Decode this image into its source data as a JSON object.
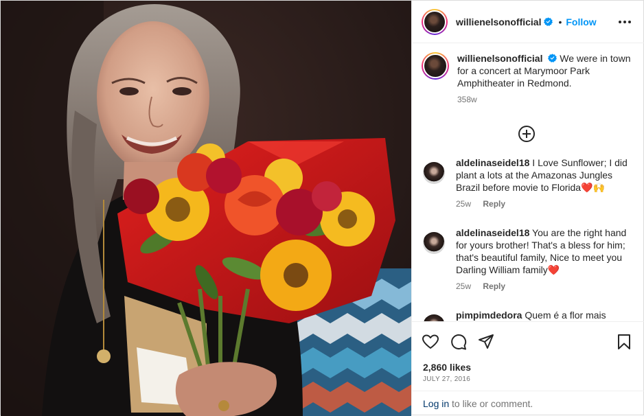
{
  "post": {
    "username": "willienelsonofficial",
    "follow_label": "Follow",
    "separator": "•",
    "verified": true,
    "caption": "We were in town for a concert at Marymoor Park Amphitheater in Redmond.",
    "caption_age": "358w",
    "likes": "2,860 likes",
    "date": "JULY 27, 2016"
  },
  "comments": [
    {
      "username": "aldelinaseidel18",
      "text": "I Love Sunflower; I did plant a lots at the Amazonas Jungles Brazil before movie to Florida❤️🙌",
      "age": "25w",
      "reply_label": "Reply"
    },
    {
      "username": "aldelinaseidel18",
      "text": "You are the right hand for yours brother! That's a bless for him; that's beautiful family, Nice to meet you Darling William family❤️",
      "age": "25w",
      "reply_label": "Reply"
    },
    {
      "username": "pimpimdedora",
      "text": "Quem é a flor mais"
    }
  ],
  "footer": {
    "login_link": "Log in",
    "login_suffix": " to like or comment."
  },
  "icons": {
    "verified": "verified-badge-icon",
    "more": "more-options-icon",
    "load_more": "plus-circle-icon",
    "like": "heart-icon",
    "comment": "comment-icon",
    "share": "share-icon",
    "save": "bookmark-icon"
  },
  "colors": {
    "accent": "#0095f6",
    "verified": "#0095f6",
    "link_dark": "#00376b",
    "muted": "#737373"
  }
}
